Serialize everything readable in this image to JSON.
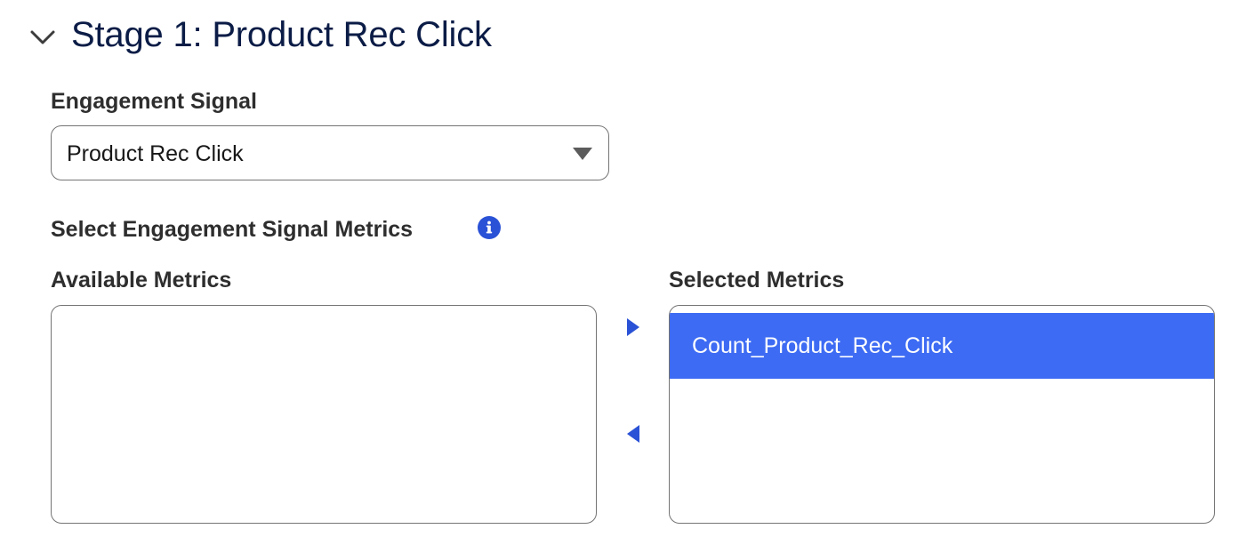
{
  "section": {
    "title": "Stage 1: Product Rec Click",
    "toggle_icon": "chevron-down-icon"
  },
  "engagement_signal": {
    "label": "Engagement Signal",
    "value": "Product Rec Click",
    "caret_icon": "caret-down-icon"
  },
  "metrics": {
    "heading": "Select Engagement Signal Metrics",
    "info_icon": "info-icon",
    "available": {
      "label": "Available Metrics",
      "options": []
    },
    "selected": {
      "label": "Selected Metrics",
      "options": [
        "Count_Product_Rec_Click"
      ]
    },
    "move_right_icon": "move-to-selected-icon",
    "move_left_icon": "move-to-available-icon"
  },
  "colors": {
    "title": "#0b1c46",
    "text": "#2e2e2e",
    "accent": "#3d6bf3",
    "icon_blue": "#2a52d6",
    "border": "#747474"
  }
}
